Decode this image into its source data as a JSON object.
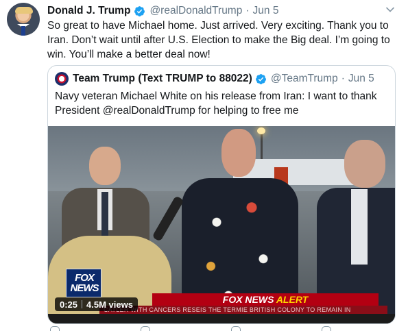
{
  "tweet": {
    "author_name": "Donald J. Trump",
    "author_handle": "@realDonaldTrump",
    "separator": "·",
    "date": "Jun 5",
    "text": "So great to have Michael home. Just arrived. Very exciting. Thank you to Iran. Don’t wait until after U.S. Election to make the Big deal. I’m going to win. You’ll make a better deal now!"
  },
  "quoted_tweet": {
    "author_name": "Team Trump (Text TRUMP to 88022)",
    "author_handle": "@TeamTrump",
    "separator": "·",
    "date": "Jun 5",
    "text": "Navy veteran Michael White on his release from Iran: I want to thank President @realDonaldTrump for helping to free me"
  },
  "video": {
    "duration": "0:25",
    "views": "4.5M views",
    "channel_logo_text": "FOX NEWS",
    "alert_brand": "FOX NEWS",
    "alert_word": "ALERT",
    "ticker_text": "CATLER WITH CANCERS RESEIS THE TERMIE BRITISH COLONY TO REMAIN IN"
  },
  "icons": {
    "verified": "verified-badge-icon",
    "menu": "chevron-down-icon",
    "reply": "reply-icon",
    "retweet": "retweet-icon",
    "like": "like-icon",
    "share": "share-icon"
  },
  "colors": {
    "verified_blue": "#1da1f2",
    "secondary_text": "#657786",
    "alert_red": "#b30012",
    "alert_yellow": "#ffd400"
  }
}
